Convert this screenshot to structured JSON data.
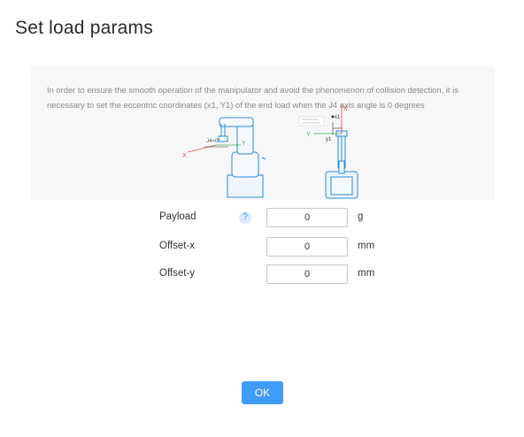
{
  "dialog": {
    "title": "Set load params",
    "info_text": "In order to ensure the smooth operation of the manipulator and avoid the phenomenon of collision detection, it is necessary to set the eccentric coordinates (x1, Y1) of the end load when the J4 axis angle is 0 degrees",
    "diagram_labels": {
      "x_left": "X",
      "y_left": "Y",
      "j4": "J4=0°",
      "x_right": "X",
      "y_right": "Y",
      "x1": "x1",
      "y1": "y1"
    }
  },
  "form": {
    "rows": [
      {
        "label": "Payload",
        "value": "0",
        "unit": "g",
        "help": "?"
      },
      {
        "label": "Offset-x",
        "value": "0",
        "unit": "mm"
      },
      {
        "label": "Offset-y",
        "value": "0",
        "unit": "mm"
      }
    ]
  },
  "actions": {
    "ok_label": "OK"
  },
  "colors": {
    "accent": "#3f9cf8",
    "panel_bg": "#f6f7f9",
    "robot_line": "#2b8ad6"
  }
}
